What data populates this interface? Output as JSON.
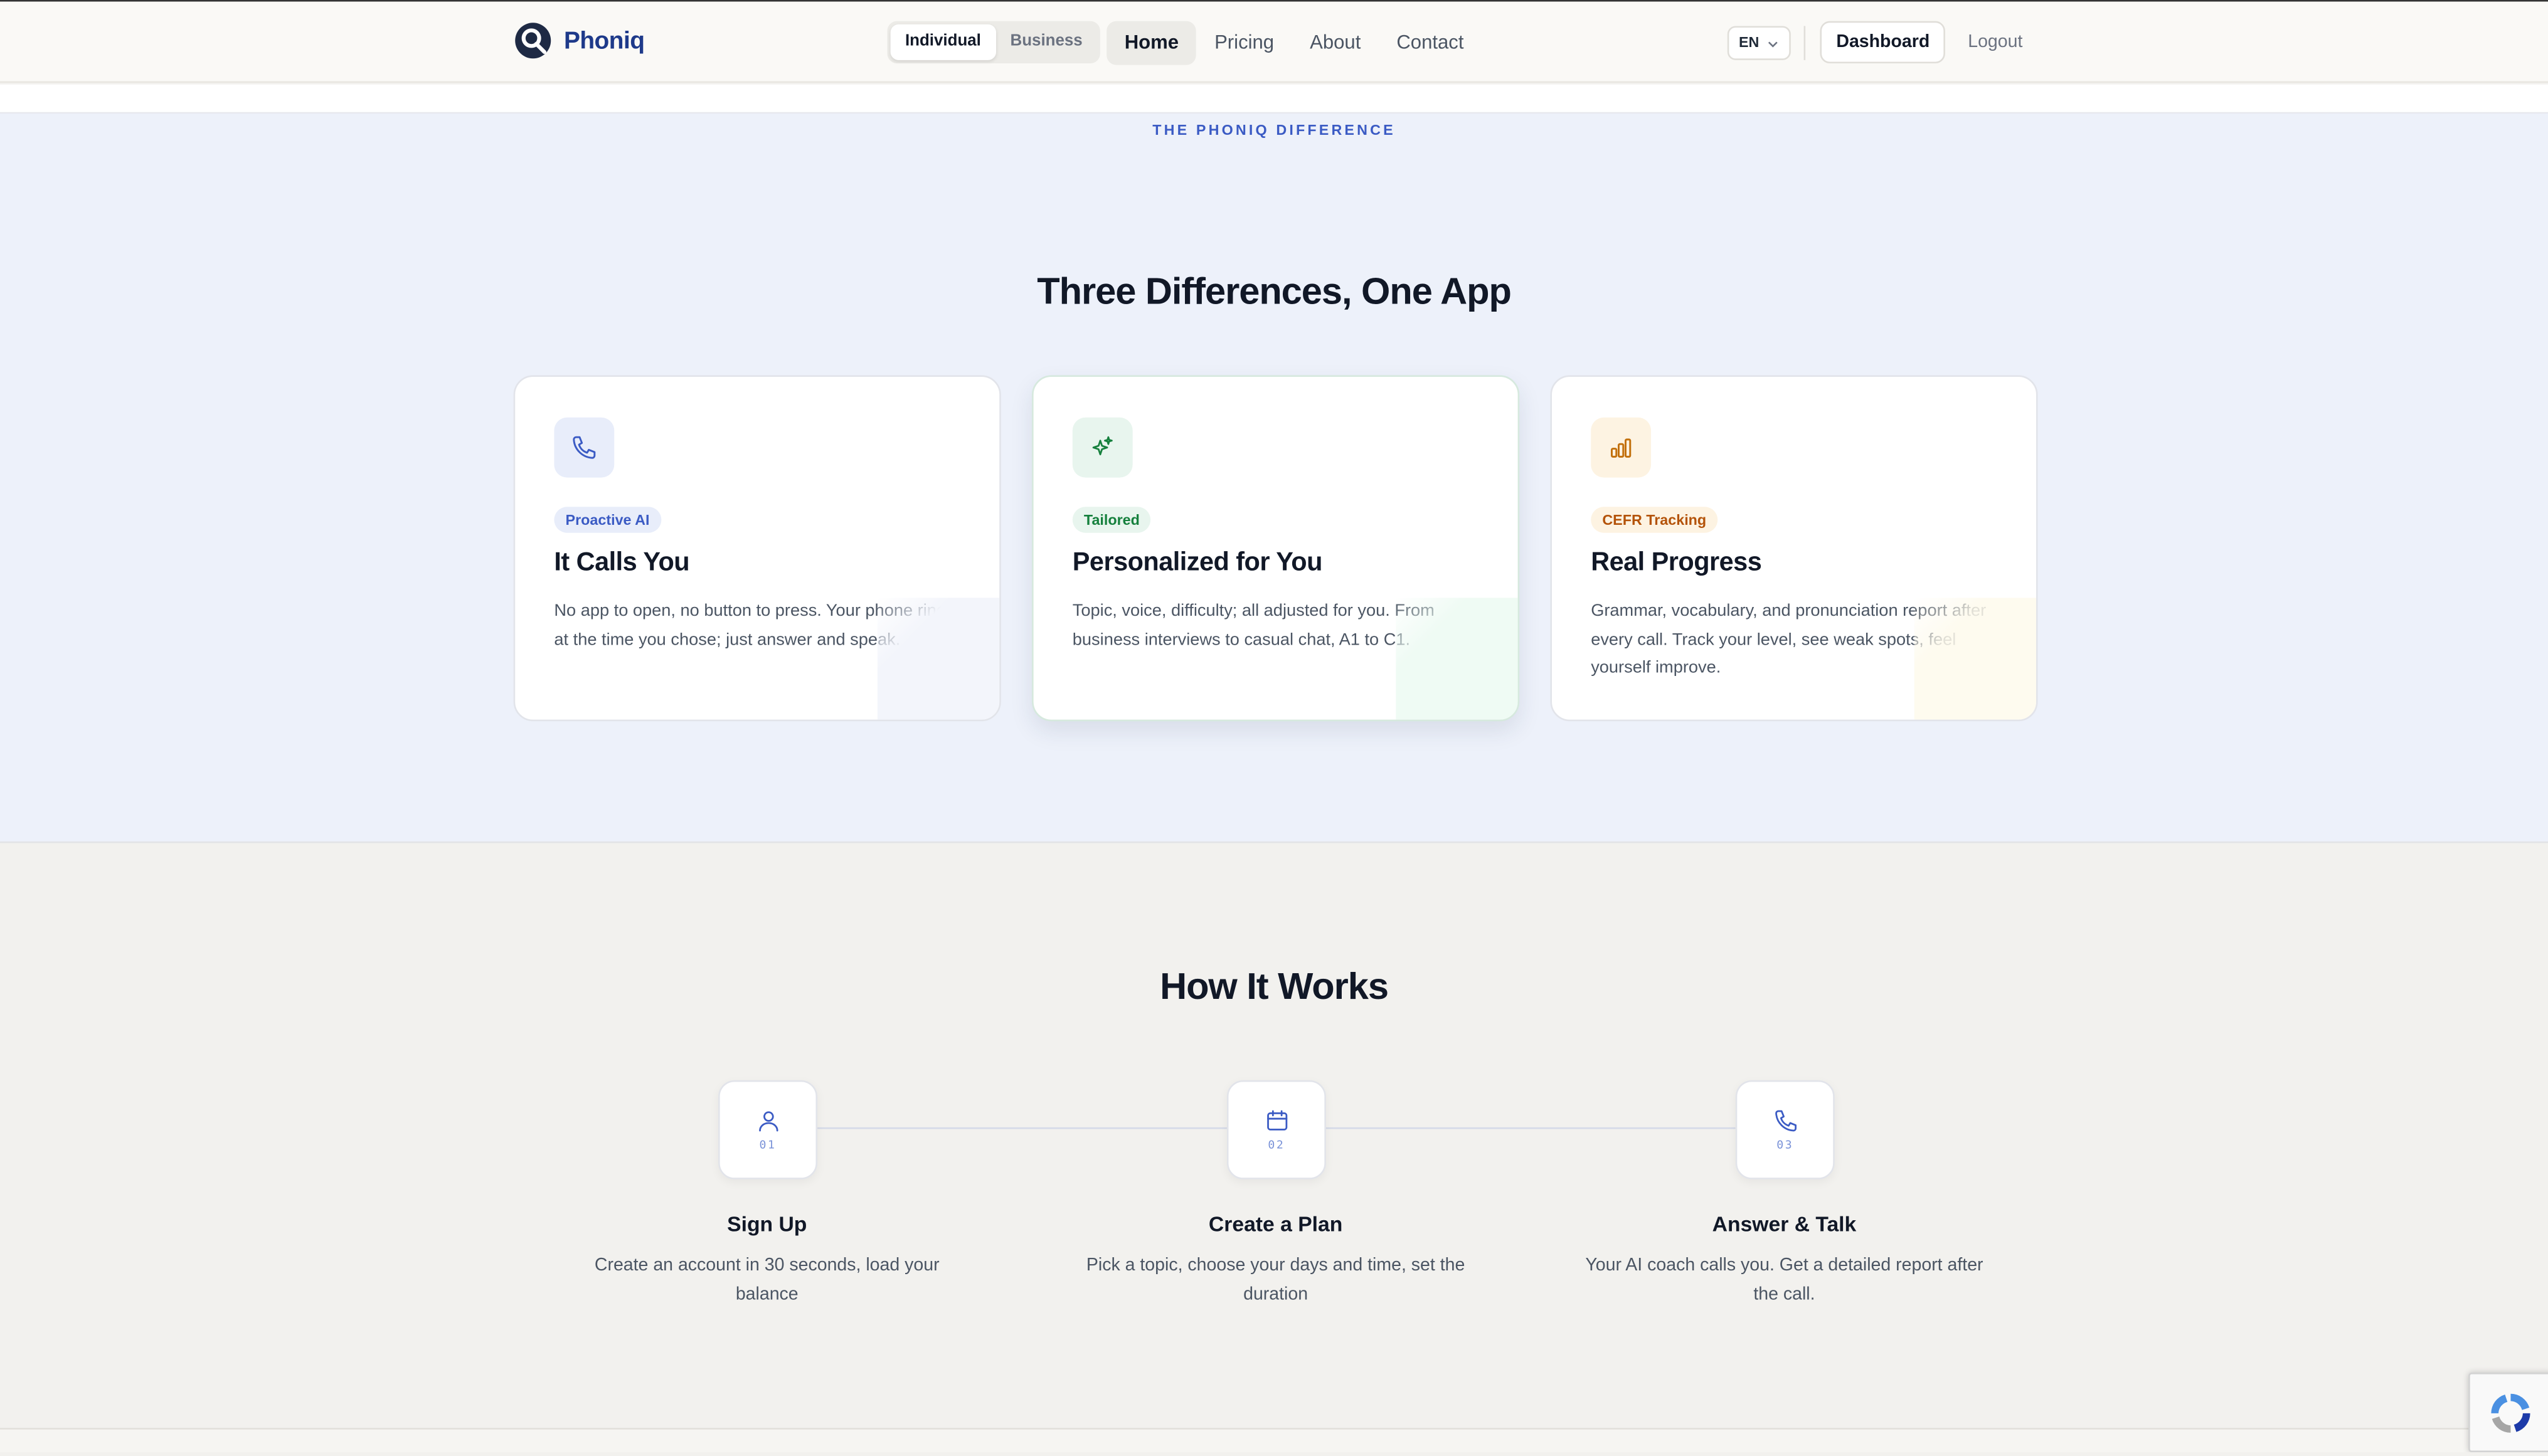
{
  "brand": {
    "name": "Phoniq"
  },
  "header": {
    "segment": [
      "Individual",
      "Business"
    ],
    "nav": [
      "Home",
      "Pricing",
      "About",
      "Contact"
    ],
    "lang": "EN",
    "dashboard": "Dashboard",
    "logout": "Logout"
  },
  "difference": {
    "eyebrow": "THE PHONIQ DIFFERENCE",
    "title": "Three Differences, One App",
    "cards": [
      {
        "badge": "Proactive AI",
        "title": "It Calls You",
        "text": "No app to open, no button to press. Your phone rings at the time you chose; just answer and speak.",
        "icon": "phone-icon",
        "accent": "#3b5bc4"
      },
      {
        "badge": "Tailored",
        "title": "Personalized for You",
        "text": "Topic, voice, difficulty; all adjusted for you. From business interviews to casual chat, A1 to C1.",
        "icon": "sparkles-icon",
        "accent": "#15803d"
      },
      {
        "badge": "CEFR Tracking",
        "title": "Real Progress",
        "text": "Grammar, vocabulary, and pronunciation report after every call. Track your level, see weak spots, feel yourself improve.",
        "icon": "bar-chart-icon",
        "accent": "#c2700c"
      }
    ]
  },
  "how": {
    "title": "How It Works",
    "steps": [
      {
        "num": "01",
        "title": "Sign Up",
        "text": "Create an account in 30 seconds, load your balance",
        "icon": "user-icon"
      },
      {
        "num": "02",
        "title": "Create a Plan",
        "text": "Pick a topic, choose your days and time, set the duration",
        "icon": "calendar-icon"
      },
      {
        "num": "03",
        "title": "Answer & Talk",
        "text": "Your AI coach calls you. Get a detailed report after the call.",
        "icon": "phone-icon"
      }
    ]
  }
}
